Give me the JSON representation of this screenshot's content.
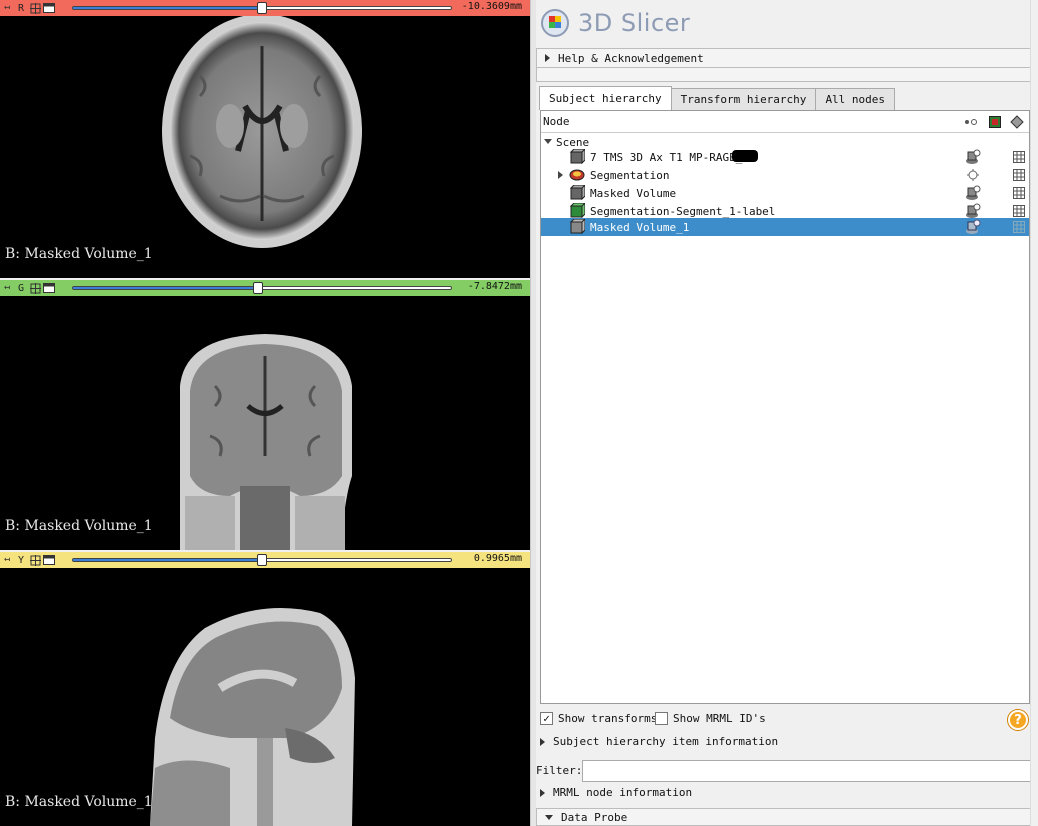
{
  "app": {
    "title": "3D Slicer"
  },
  "slice_views": [
    {
      "letter": "R",
      "color": "#f26a5b",
      "offset": "-10.3609mm",
      "slider_fraction": 0.5,
      "label": "B: Masked Volume_1"
    },
    {
      "letter": "G",
      "color": "#84cc64",
      "offset": "-7.8472mm",
      "slider_fraction": 0.49,
      "label": "B: Masked Volume_1"
    },
    {
      "letter": "Y",
      "color": "#f4e37e",
      "offset": "0.9965mm",
      "slider_fraction": 0.5,
      "label": "B: Masked Volume_1"
    }
  ],
  "panel": {
    "help_section": "Help & Acknowledgement",
    "tabs": [
      "Subject hierarchy",
      "Transform hierarchy",
      "All nodes"
    ],
    "active_tab": 0,
    "tree_header": {
      "node": "Node"
    },
    "tree_rows": [
      {
        "name": "Scene",
        "level": 0,
        "expanded": true,
        "icon": "scene-icon",
        "selected": false
      },
      {
        "name": "7 TMS  3D Ax T1 MP-RAGE_",
        "level": 1,
        "icon": "volume-icon",
        "selected": false
      },
      {
        "name": "Segmentation",
        "level": 1,
        "collapsed": true,
        "icon": "segmentation-icon",
        "selected": false
      },
      {
        "name": "Masked Volume",
        "level": 1,
        "icon": "volume-icon",
        "selected": false
      },
      {
        "name": "Segmentation-Segment_1-label",
        "level": 1,
        "icon": "labelmap-icon",
        "selected": false
      },
      {
        "name": "Masked Volume_1",
        "level": 1,
        "icon": "volume-icon",
        "selected": true
      }
    ],
    "show_transforms": {
      "label": "Show transforms",
      "checked": true
    },
    "show_mrml_ids": {
      "label": "Show MRML ID's",
      "checked": false
    },
    "item_info_section": "Subject hierarchy item information",
    "filter": {
      "label": "Filter:",
      "value": ""
    },
    "mrml_info_section": "MRML node information",
    "data_probe_section": "Data Probe"
  }
}
